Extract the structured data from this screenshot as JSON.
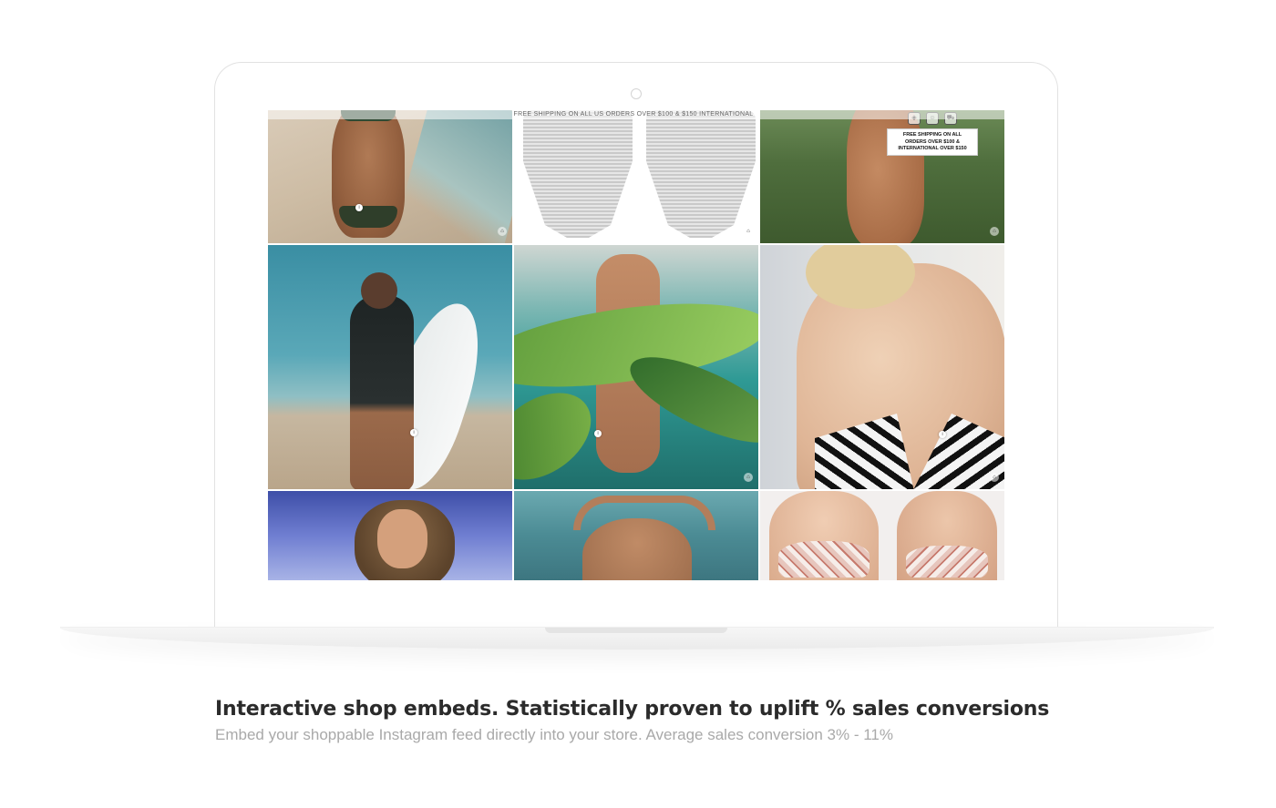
{
  "screen": {
    "shipping_banner": "FREE SHIPPING ON ALL US ORDERS OVER $100 & $150 INTERNATIONAL",
    "popup": {
      "line1": "FREE SHIPPING ON ALL",
      "line2": "ORDERS OVER $100 &",
      "line3": "INTERNATIONAL OVER $150"
    },
    "tiles": [
      {
        "name": "beach-bikini-tile",
        "has_tag": true
      },
      {
        "name": "swimsuit-product-tile",
        "has_tag": false
      },
      {
        "name": "grass-bikini-tile",
        "has_tag": true
      },
      {
        "name": "surfer-tile",
        "has_tag": true
      },
      {
        "name": "tropical-leaves-tile",
        "has_tag": true
      },
      {
        "name": "striped-top-tile",
        "has_tag": true
      },
      {
        "name": "runway-tile",
        "has_tag": false
      },
      {
        "name": "ocean-back-tile",
        "has_tag": false
      },
      {
        "name": "floral-bikini-tile",
        "has_tag": false
      }
    ],
    "tag_glyph": "i",
    "bag_icon": "shopping-bag-icon"
  },
  "caption": {
    "title": "Interactive shop embeds. Statistically proven to uplift % sales conversions",
    "subtitle": "Embed your shoppable Instagram feed directly into your store. Average sales conversion 3% - 11%"
  },
  "colors": {
    "title": "#2b2b2b",
    "subtitle": "#a9a9a9"
  }
}
